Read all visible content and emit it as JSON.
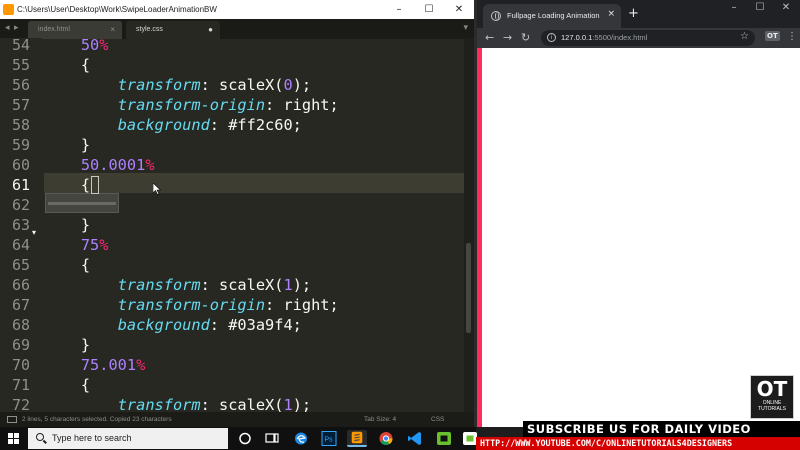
{
  "editor": {
    "window_title": "C:\\Users\\User\\Desktop\\Work\\SwipeLoaderAnimationBW",
    "tabs": [
      {
        "label": "index.html",
        "close": "×"
      },
      {
        "label": "style.css",
        "close": "●"
      }
    ],
    "lines": [
      {
        "num": "54",
        "indent": "    ",
        "tokens": [
          {
            "t": "num",
            "v": "50"
          },
          {
            "t": "pct",
            "v": "%"
          }
        ]
      },
      {
        "num": "55",
        "indent": "    ",
        "tokens": [
          {
            "t": "plain",
            "v": "{"
          }
        ]
      },
      {
        "num": "56",
        "indent": "        ",
        "tokens": [
          {
            "t": "prop",
            "v": "transform"
          },
          {
            "t": "plain",
            "v": ": scaleX("
          },
          {
            "t": "num",
            "v": "0"
          },
          {
            "t": "plain",
            "v": ");"
          }
        ]
      },
      {
        "num": "57",
        "indent": "        ",
        "tokens": [
          {
            "t": "prop",
            "v": "transform-origin"
          },
          {
            "t": "plain",
            "v": ": right;"
          }
        ]
      },
      {
        "num": "58",
        "indent": "        ",
        "tokens": [
          {
            "t": "prop",
            "v": "background"
          },
          {
            "t": "plain",
            "v": ": #ff2c60;"
          }
        ]
      },
      {
        "num": "59",
        "indent": "    ",
        "tokens": [
          {
            "t": "plain",
            "v": "}"
          }
        ]
      },
      {
        "num": "60",
        "indent": "    ",
        "tokens": [
          {
            "t": "num",
            "v": "50.0001"
          },
          {
            "t": "pct",
            "v": "%"
          }
        ]
      },
      {
        "num": "61",
        "indent": "    ",
        "tokens": [
          {
            "t": "plain",
            "v": "{"
          }
        ]
      },
      {
        "num": "62",
        "indent": "",
        "tokens": []
      },
      {
        "num": "63",
        "indent": "    ",
        "tokens": [
          {
            "t": "plain",
            "v": "}"
          }
        ]
      },
      {
        "num": "64",
        "indent": "    ",
        "tokens": [
          {
            "t": "num",
            "v": "75"
          },
          {
            "t": "pct",
            "v": "%"
          }
        ]
      },
      {
        "num": "65",
        "indent": "    ",
        "tokens": [
          {
            "t": "plain",
            "v": "{"
          }
        ]
      },
      {
        "num": "66",
        "indent": "        ",
        "tokens": [
          {
            "t": "prop",
            "v": "transform"
          },
          {
            "t": "plain",
            "v": ": scaleX("
          },
          {
            "t": "num",
            "v": "1"
          },
          {
            "t": "plain",
            "v": ");"
          }
        ]
      },
      {
        "num": "67",
        "indent": "        ",
        "tokens": [
          {
            "t": "prop",
            "v": "transform-origin"
          },
          {
            "t": "plain",
            "v": ": right;"
          }
        ]
      },
      {
        "num": "68",
        "indent": "        ",
        "tokens": [
          {
            "t": "prop",
            "v": "background"
          },
          {
            "t": "plain",
            "v": ": #03a9f4;"
          }
        ]
      },
      {
        "num": "69",
        "indent": "    ",
        "tokens": [
          {
            "t": "plain",
            "v": "}"
          }
        ]
      },
      {
        "num": "70",
        "indent": "    ",
        "tokens": [
          {
            "t": "num",
            "v": "75.001"
          },
          {
            "t": "pct",
            "v": "%"
          }
        ]
      },
      {
        "num": "71",
        "indent": "    ",
        "tokens": [
          {
            "t": "plain",
            "v": "{"
          }
        ]
      },
      {
        "num": "72",
        "indent": "        ",
        "tokens": [
          {
            "t": "prop",
            "v": "transform"
          },
          {
            "t": "plain",
            "v": ": scaleX("
          },
          {
            "t": "num",
            "v": "1"
          },
          {
            "t": "plain",
            "v": ");"
          }
        ]
      }
    ],
    "current_line": "61",
    "status": {
      "selection": "2 lines, 5 characters selected. Copied 23 characters",
      "tab_size": "Tab Size: 4",
      "syntax": "CSS"
    }
  },
  "browser": {
    "tab_title": "Fullpage Loading Animation",
    "tab_close": "×",
    "new_tab": "+",
    "url_host": "127.0.0.1",
    "url_path": ":5500/index.html",
    "extension_label": "OT",
    "loader_color": "#ff2c60"
  },
  "taskbar": {
    "search_placeholder": "Type here to search"
  },
  "overlay": {
    "logo_text": "OT",
    "logo_line1": "ONLINE",
    "logo_line2": "TUTORIALS",
    "subscribe": "SUBSCRIBE US FOR DAILY VIDEO",
    "channel_url": "HTTP://WWW.YOUTUBE.COM/C/ONLINETUTORIALS4DESIGNERS"
  },
  "colors": {
    "editor_bg": "#272822",
    "keyword_pct": "#f92672",
    "number": "#ae81ff",
    "property": "#66d9ef",
    "banner_red": "#d50000"
  }
}
